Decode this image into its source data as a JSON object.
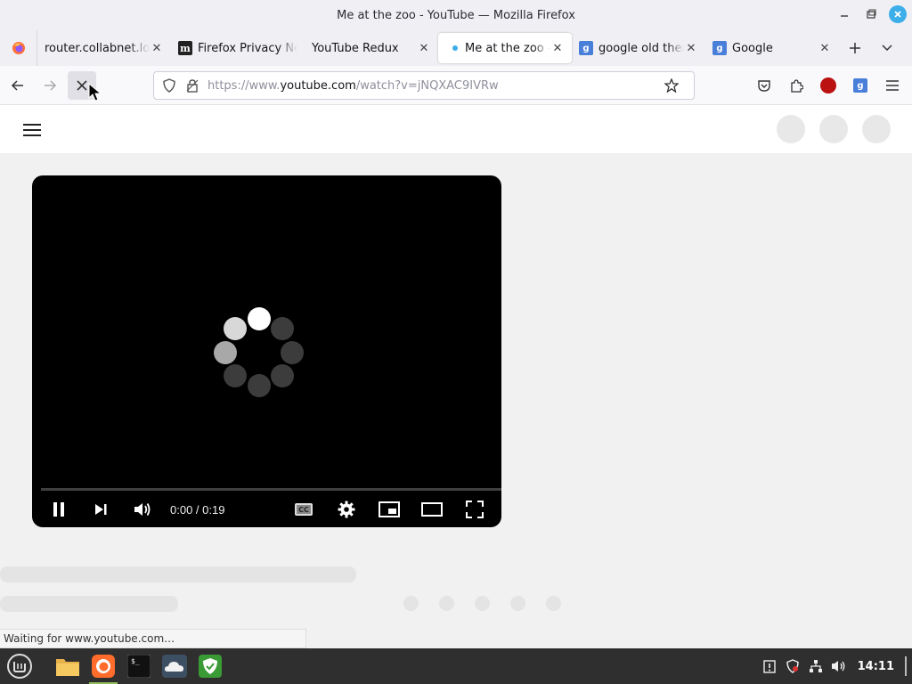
{
  "window": {
    "title": "Me at the zoo - YouTube — Mozilla Firefox",
    "minimize_icon": "minimize-icon",
    "maximize_icon": "maximize-icon",
    "close_icon": "close-icon"
  },
  "tabs": [
    {
      "label": "router.collabnet.local",
      "favicon": "none",
      "active": false
    },
    {
      "label": "Firefox Privacy Notice",
      "favicon": "mozilla-m",
      "active": false
    },
    {
      "label": "YouTube Redux",
      "favicon": "none",
      "active": false
    },
    {
      "label": "Me at the zoo - YouTube",
      "favicon": "loading-dot",
      "active": true
    },
    {
      "label": "google old theme",
      "favicon": "google-g",
      "active": false
    },
    {
      "label": "Google",
      "favicon": "google-g",
      "active": false
    }
  ],
  "tab_favicon_letters": {
    "google": "g",
    "mozilla": "m"
  },
  "navbar": {
    "url_prefix": "https://www.",
    "url_host": "youtube.com",
    "url_path": "/watch?v=jNQXAC9IVRw"
  },
  "player": {
    "time": "0:00 / 0:19",
    "cc_label": "CC",
    "state": "loading"
  },
  "status": {
    "text": "Waiting for www.youtube.com…"
  },
  "taskbar": {
    "clock": "14:11"
  },
  "colors": {
    "accent": "#3daee9",
    "taskbar": "#2f2f2f",
    "player_bg": "#000000",
    "google_favicon": "#4a7fd9"
  }
}
